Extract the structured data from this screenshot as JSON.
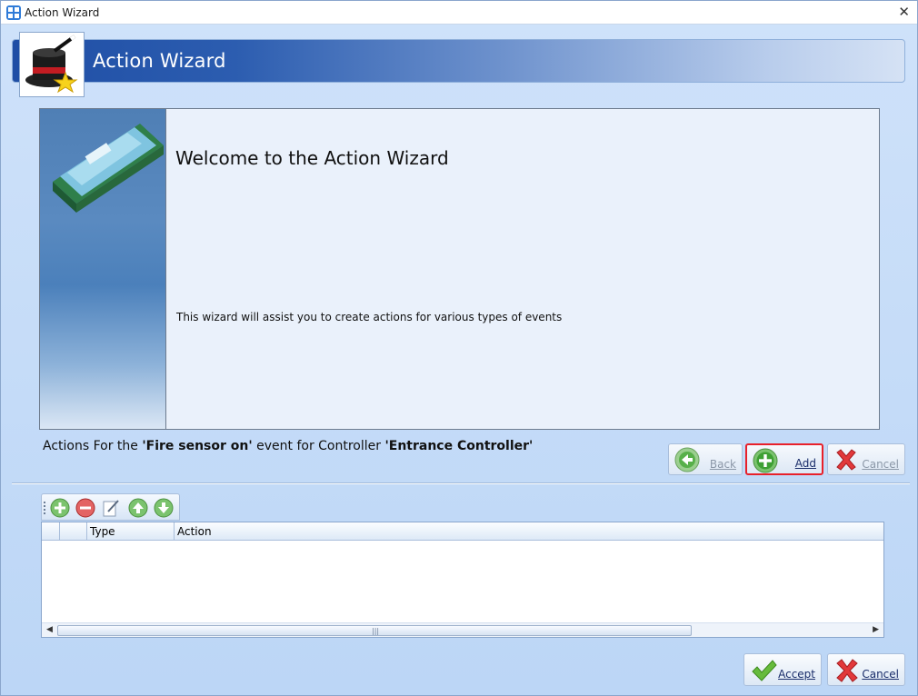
{
  "window": {
    "title": "Action Wizard",
    "icon": "grid-app-icon",
    "close_icon": "close-icon"
  },
  "banner": {
    "title": "Action Wizard",
    "logo_icon": "magic-hat-icon"
  },
  "welcome": {
    "title": "Welcome to the Action Wizard",
    "description": "This wizard will assist you to create actions for various types of events",
    "side_image": "controller-board-image"
  },
  "caption": {
    "prefix": "Actions  For  the ",
    "event": "'Fire sensor on'",
    "middle": " event  for  Controller ",
    "controller": "'Entrance Controller'"
  },
  "nav_buttons": {
    "back_label": "Back",
    "add_label": "Add",
    "cancel_label": "Cancel"
  },
  "toolbar": {
    "items": [
      "add-icon",
      "remove-icon",
      "edit-icon",
      "move-up-icon",
      "move-down-icon"
    ]
  },
  "grid": {
    "columns": [
      "",
      "",
      "Type",
      "Action"
    ],
    "rows": []
  },
  "footer": {
    "accept_label": "Accept",
    "cancel_label": "Cancel"
  },
  "colors": {
    "banner_dark": "#1f4ea5",
    "highlight_border": "#e8202a",
    "window_bg": "#c3daf7"
  }
}
